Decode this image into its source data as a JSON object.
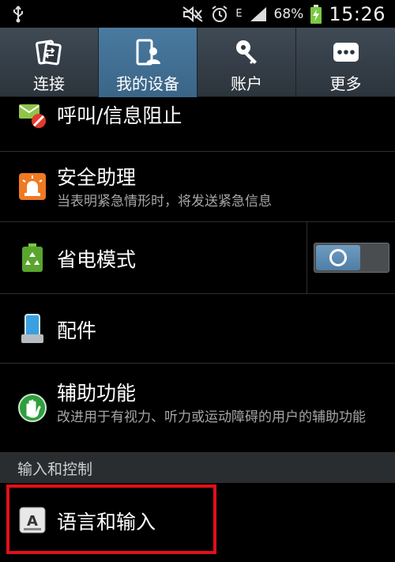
{
  "status_bar": {
    "battery_text": "68%",
    "network_label": "E",
    "time": "15:26",
    "icons": [
      "usb-icon",
      "mute-icon",
      "alarm-icon",
      "signal-icon",
      "battery-charging-icon"
    ]
  },
  "tabs": [
    {
      "label": "连接",
      "icon": "connections-icon",
      "active": false
    },
    {
      "label": "我的设备",
      "icon": "my-device-icon",
      "active": true
    },
    {
      "label": "账户",
      "icon": "accounts-icon",
      "active": false
    },
    {
      "label": "更多",
      "icon": "more-icon",
      "active": false
    }
  ],
  "items": {
    "call_block": {
      "title": "呼叫/信息阻止",
      "icon": "call-block-icon"
    },
    "safety": {
      "title": "安全助理",
      "subtitle": "当表明紧急情形时，将发送紧急信息",
      "icon": "emergency-icon"
    },
    "power_saving": {
      "title": "省电模式",
      "icon": "battery-recycle-icon",
      "toggle_state": "on"
    },
    "accessories": {
      "title": "配件",
      "icon": "phone-accessory-icon"
    },
    "accessibility": {
      "title": "辅助功能",
      "subtitle": "改进用于有视力、听力或运动障碍的用户的辅助功能",
      "icon": "hand-icon"
    }
  },
  "section_header": "输入和控制",
  "language_input": {
    "title": "语言和输入",
    "icon": "keyboard-a-icon"
  },
  "colors": {
    "active_tab": "#4a7aa0",
    "highlight": "#e0101a",
    "section_bg": "#2a2d30"
  }
}
